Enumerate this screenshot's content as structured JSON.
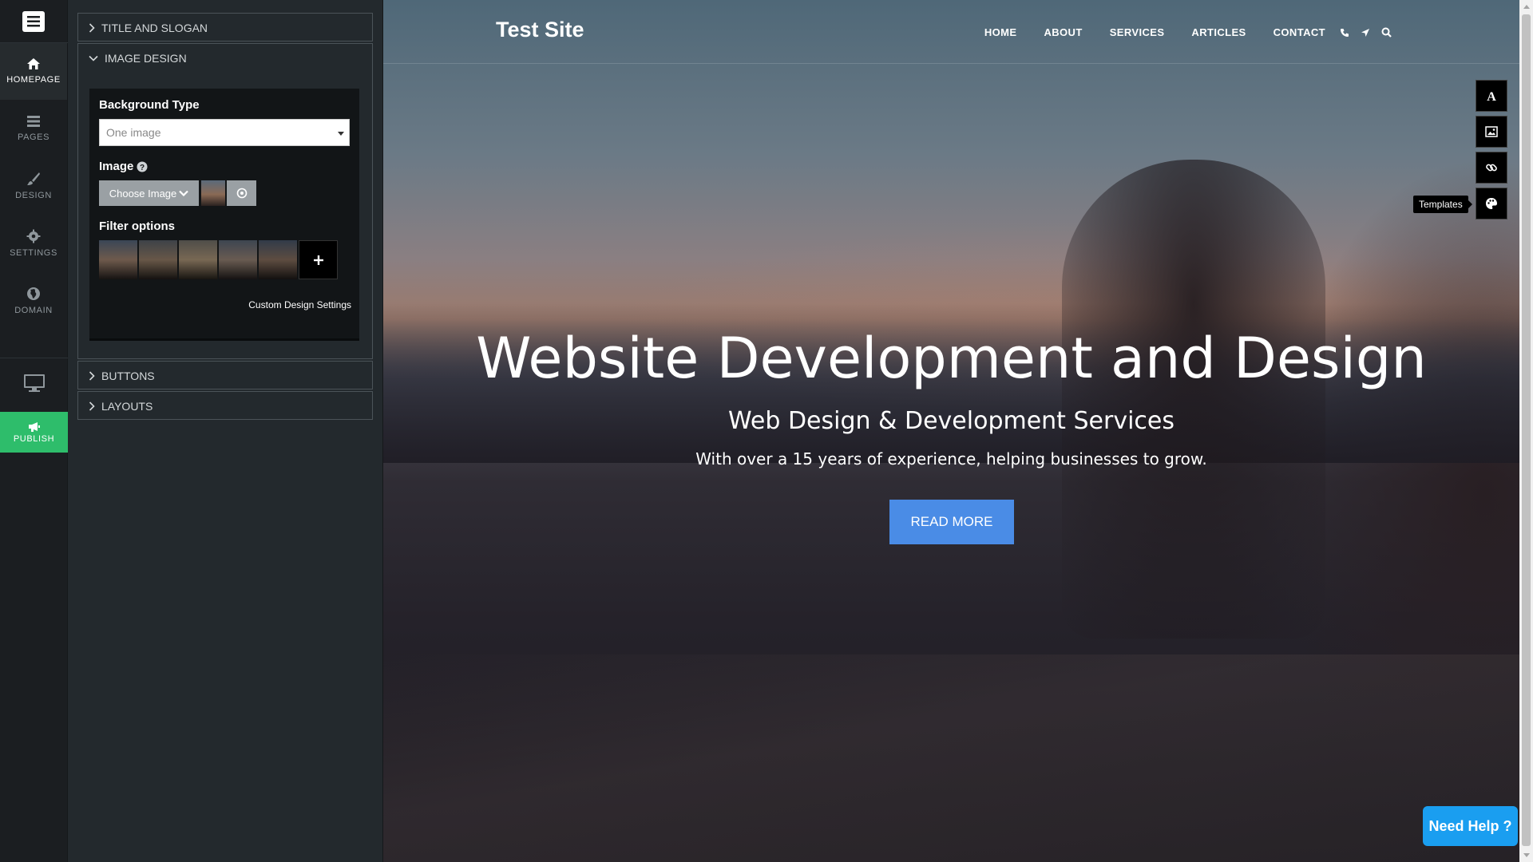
{
  "rail": {
    "items": [
      {
        "label": "HOMEPAGE",
        "icon": "home-icon"
      },
      {
        "label": "PAGES",
        "icon": "pages-icon"
      },
      {
        "label": "DESIGN",
        "icon": "brush-icon"
      },
      {
        "label": "SETTINGS",
        "icon": "gear-icon"
      },
      {
        "label": "DOMAIN",
        "icon": "globe-icon"
      }
    ],
    "publish_label": "PUBLISH",
    "publish_color": "#2ebd6b"
  },
  "panel": {
    "sections": [
      {
        "label": "TITLE AND SLOGAN",
        "expanded": false
      },
      {
        "label": "IMAGE DESIGN",
        "expanded": true
      },
      {
        "label": "BUTTONS",
        "expanded": false
      },
      {
        "label": "LAYOUTS",
        "expanded": false
      }
    ],
    "image_design": {
      "background_type_label": "Background Type",
      "background_type_value": "One image",
      "image_label": "Image",
      "choose_image_label": "Choose Image",
      "filter_options_label": "Filter options",
      "filter_count": 5,
      "custom_settings_label": "Custom Design Settings"
    }
  },
  "preview": {
    "site_title": "Test Site",
    "nav": [
      "HOME",
      "ABOUT",
      "SERVICES",
      "ARTICLES",
      "CONTACT"
    ],
    "hero_title": "Website Development and Design",
    "hero_subtitle": "Web Design & Development Services",
    "hero_text": "With over a 15 years of experience, helping businesses to grow.",
    "cta_label": "READ MORE",
    "cta_color": "#4a8ce6",
    "tools": [
      "font-icon",
      "image-icon",
      "link-icon",
      "palette-icon"
    ],
    "tooltip": "Templates",
    "help_label": "Need Help ?",
    "help_color": "#1a9ef0"
  }
}
